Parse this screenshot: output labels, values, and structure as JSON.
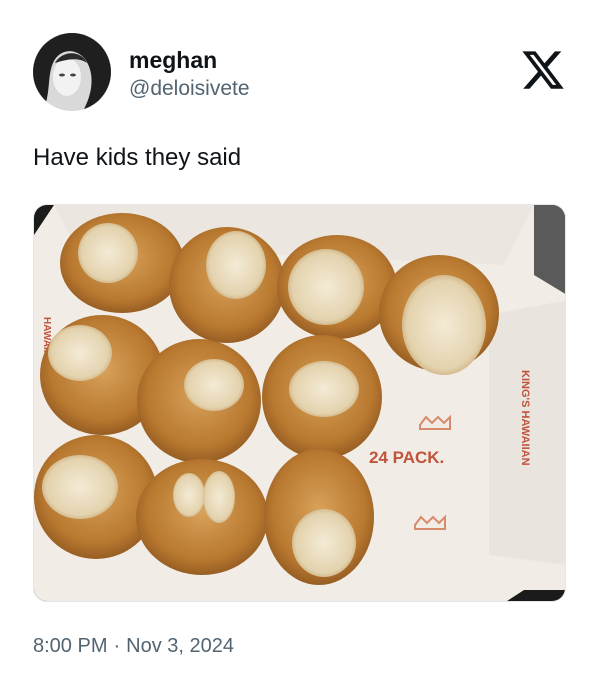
{
  "author": {
    "display_name": "meghan",
    "handle": "@deloisivete"
  },
  "platform_icon": "x-logo-icon",
  "tweet": {
    "text": "Have kids they said"
  },
  "media": {
    "box_label": "24 PACK.",
    "side_label": "KING'S HAWAIIAN",
    "edge_label": "HAWAIIAN"
  },
  "timestamp": {
    "time": "8:00 PM",
    "separator": "·",
    "date": "Nov 3, 2024"
  },
  "colors": {
    "text_primary": "#0f1419",
    "text_secondary": "#536471",
    "box_print": "#c0533b"
  }
}
